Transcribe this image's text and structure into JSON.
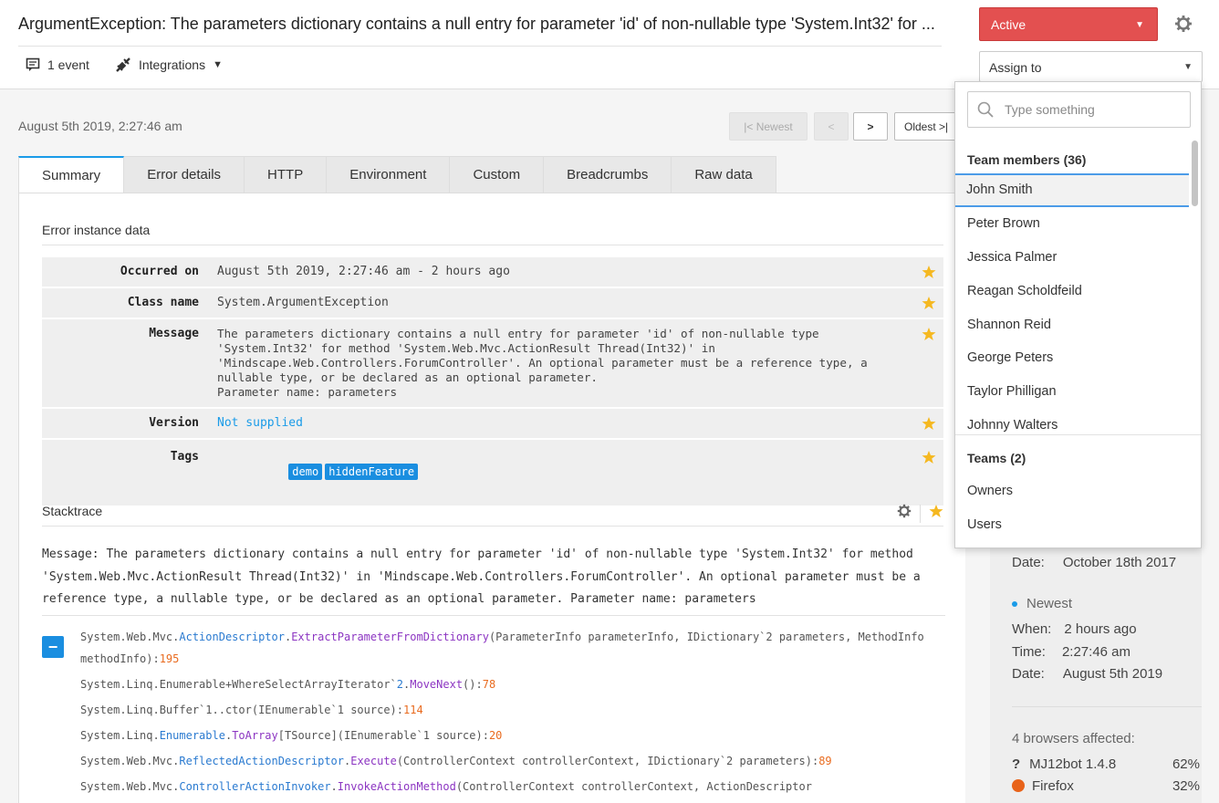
{
  "header": {
    "title": "ArgumentException: The parameters dictionary contains a null entry for parameter 'id' of non-nullable type 'System.Int32' for ...",
    "events_label": "1 event",
    "integrations_label": "Integrations",
    "status_label": "Active",
    "assign_label": "Assign to"
  },
  "instance": {
    "date": "August 5th 2019, 2:27:46 am",
    "newest_label": "|< Newest",
    "prev_label": "<",
    "next_label": ">",
    "oldest_label": "Oldest >|"
  },
  "tabs": [
    "Summary",
    "Error details",
    "HTTP",
    "Environment",
    "Custom",
    "Breadcrumbs",
    "Raw data"
  ],
  "error_data": {
    "title": "Error instance data",
    "rows": [
      {
        "key": "Occurred on",
        "value": "August 5th 2019, 2:27:46 am - 2 hours ago"
      },
      {
        "key": "Class name",
        "value": "System.ArgumentException"
      },
      {
        "key": "Message",
        "value": "The parameters dictionary contains a null entry for parameter 'id' of non-nullable type\n'System.Int32' for method 'System.Web.Mvc.ActionResult Thread(Int32)' in\n'Mindscape.Web.Controllers.ForumController'. An optional parameter must be a reference type, a\nnullable type, or be declared as an optional parameter.\nParameter name: parameters"
      },
      {
        "key": "Version",
        "value": "Not supplied"
      },
      {
        "key": "Tags",
        "tags": [
          "demo",
          "hiddenFeature"
        ]
      }
    ]
  },
  "stacktrace": {
    "title": "Stacktrace",
    "message": "Message: The parameters dictionary contains a null entry for parameter 'id' of non-nullable type 'System.Int32' for method 'System.Web.Mvc.ActionResult Thread(Int32)' in 'Mindscape.Web.Controllers.ForumController'. An optional parameter must be a reference type, a nullable type, or be declared as an optional parameter. Parameter name: parameters",
    "frames": [
      {
        "ns": "System.Web.Mvc.",
        "cls": "ActionDescriptor",
        "sep": ".",
        "method": "ExtractParameterFromDictionary",
        "args": "(ParameterInfo parameterInfo, IDictionary`2 parameters, MethodInfo methodInfo):",
        "line": "195"
      },
      {
        "ns": "System.Linq.Enumerable+WhereSelectArrayIterator`",
        "cls": "2",
        "sep": ".",
        "method": "MoveNext",
        "args": "():",
        "line": "78"
      },
      {
        "ns": "System.Linq.Buffer`1..ctor(IEnumerable`1 source):",
        "cls": "",
        "sep": "",
        "method": "",
        "args": "",
        "line": "114"
      },
      {
        "ns": "System.Linq.",
        "cls": "Enumerable",
        "sep": ".",
        "method": "ToArray",
        "args": "[TSource](IEnumerable`1 source):",
        "line": "20"
      },
      {
        "ns": "System.Web.Mvc.",
        "cls": "ReflectedActionDescriptor",
        "sep": ".",
        "method": "Execute",
        "args": "(ControllerContext controllerContext, IDictionary`2 parameters):",
        "line": "89"
      },
      {
        "ns": "System.Web.Mvc.",
        "cls": "ControllerActionInvoker",
        "sep": ".",
        "method": "InvokeActionMethod",
        "args": "(ControllerContext controllerContext, ActionDescriptor",
        "line": ""
      }
    ]
  },
  "sidebar": {
    "first_seen_date_label": "Date:",
    "first_seen_date": "October 18th 2017",
    "newest_title": "Newest",
    "when_label": "When:",
    "when": "2 hours ago",
    "time_label": "Time:",
    "time": "2:27:46 am",
    "date_label": "Date:",
    "date": "August 5th 2019",
    "browsers_title": "4 browsers affected:",
    "browsers": [
      {
        "name": "MJ12bot 1.4.8",
        "pct": "62%",
        "icon": "question-icon"
      },
      {
        "name": "Firefox",
        "pct": "32%",
        "icon": "firefox-icon"
      }
    ]
  },
  "dropdown": {
    "search_placeholder": "Type something",
    "members_title": "Team members (36)",
    "members": [
      "John Smith",
      "Peter Brown",
      "Jessica Palmer",
      "Reagan Scholdfeild",
      "Shannon Reid",
      "George Peters",
      "Taylor Philligan",
      "Johnny Walters"
    ],
    "teams_title": "Teams (2)",
    "teams": [
      "Owners",
      "Users"
    ]
  },
  "colors": {
    "status": "#e35050",
    "accent": "#1a9be8",
    "star": "#f5b820",
    "line_number": "#e96b1f"
  }
}
